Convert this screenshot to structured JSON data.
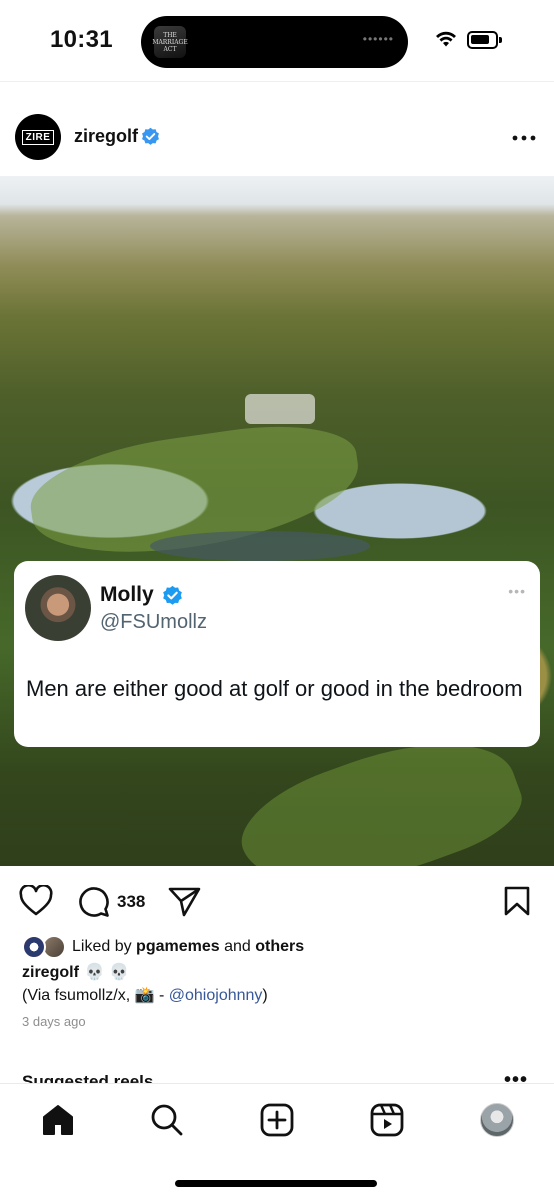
{
  "status_bar": {
    "time": "10:31",
    "now_playing_art_text": "THE MARRIAGE ACT",
    "island_dots": "••••••"
  },
  "post": {
    "avatar_text": "ZIRE",
    "username": "ziregolf",
    "verified": true,
    "more_icon": "more-horizontal-icon"
  },
  "tweet": {
    "name": "Molly",
    "handle": "@FSUmollz",
    "text": "Men are either good at golf or good in the bedroom",
    "more": "•••"
  },
  "actions": {
    "comment_count": "338"
  },
  "likes": {
    "prefix": "Liked by ",
    "user": "pgamemes",
    "middle": " and ",
    "others": "others"
  },
  "caption": {
    "username": "ziregolf",
    "emoji": "💀 💀",
    "line_prefix": "(Via fsumollz/x, 📸 - ",
    "mention": "@ohiojohnny",
    "line_suffix": ")"
  },
  "timestamp": "3 days ago",
  "suggested": {
    "label": "Suggested reels",
    "more": "•••"
  },
  "colors": {
    "verified_blue": "#3897f0",
    "mention_blue": "#385898",
    "tweet_handle_gray": "#536471"
  }
}
